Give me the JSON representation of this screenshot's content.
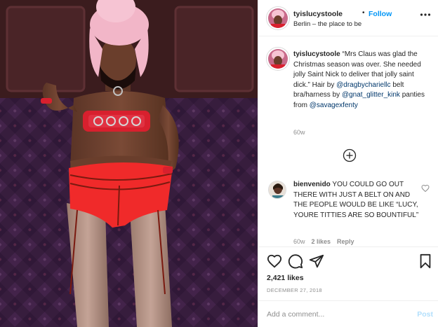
{
  "header": {
    "username": "tyislucystoole",
    "dot": "•",
    "follow_label": "Follow",
    "location": "Berlin – the place to be"
  },
  "caption": {
    "username": "tyislucystoole",
    "text_1": "“Mrs Claus was glad the Christmas season was over. She needed jolly Saint Nick to deliver that jolly saint dick.” Hair by ",
    "mention_1": "@dragbychariellc",
    "text_2": " belt bra/harness by ",
    "mention_2": "@gnat_glitter_kink",
    "text_3": " panties from ",
    "mention_3": "@savagexfenty",
    "time": "60w"
  },
  "comment": {
    "username": "bienvenido",
    "text": "YOU COULD GO OUT THERE WITH JUST A BELT ON AND THE PEOPLE WOULD BE LIKE “LUCY, YOURE TITTIES ARE SO BOUNTIFUL”",
    "time": "60w",
    "likes": "2 likes",
    "reply": "Reply"
  },
  "actions": {
    "likes_count": "2,421 likes",
    "date": "DECEMBER 27, 2018"
  },
  "add_comment": {
    "placeholder": "Add a comment...",
    "post_label": "Post"
  },
  "icons": {
    "more": "more-horizontal-icon",
    "load_more": "plus-circle-icon",
    "like": "heart-icon",
    "comment": "comment-icon",
    "share": "share-icon",
    "save": "bookmark-icon"
  },
  "colors": {
    "accent": "#0095f6",
    "link": "#00376b",
    "muted": "#8e8e8e",
    "text": "#262626",
    "post_disabled": "#b2dffc"
  }
}
